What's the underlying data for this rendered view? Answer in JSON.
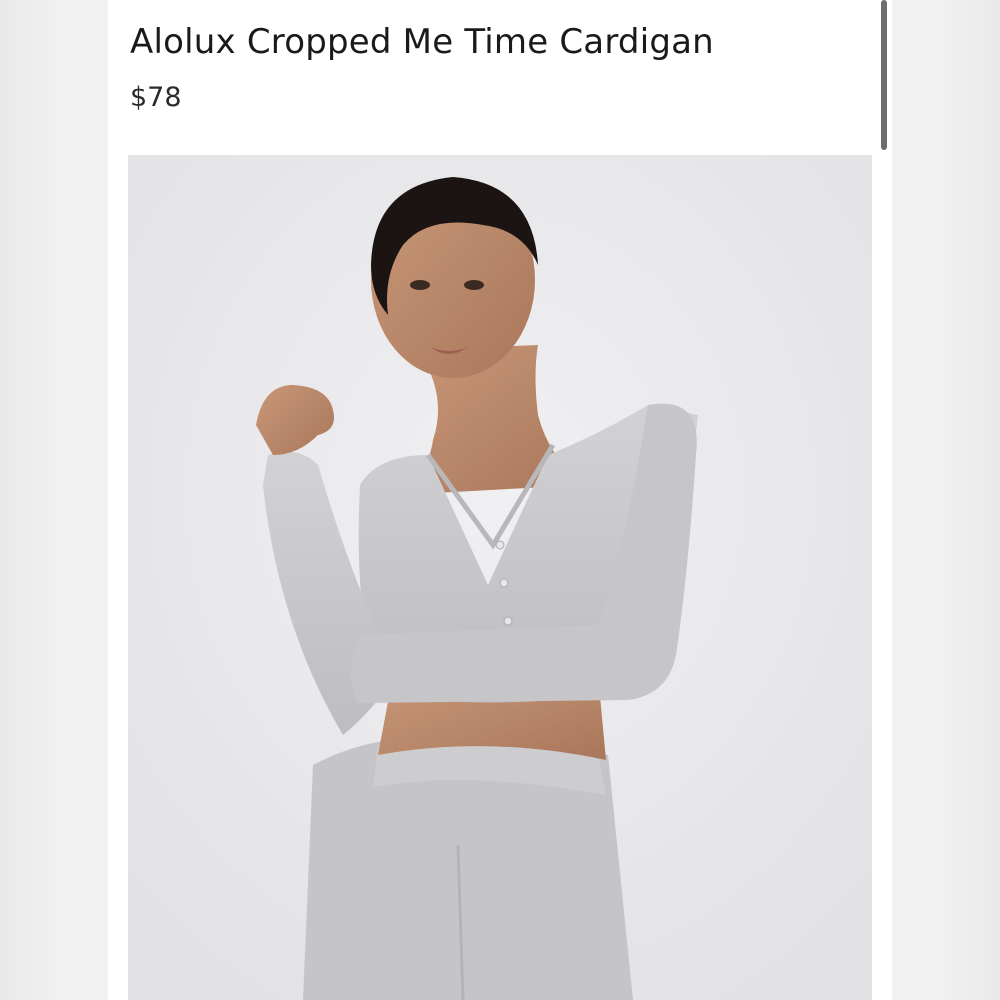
{
  "product": {
    "title": "Alolux Cropped Me Time Cardigan",
    "price": "$78",
    "image_subject": "model-wearing-grey-cropped-cardigan-photo"
  },
  "colors": {
    "panel_bg": "#ffffff",
    "page_bg": "#ececec",
    "title_text": "#1a1a1a",
    "scrollbar": "#6e6e6e",
    "garment_grey": "#c9c9cb"
  }
}
